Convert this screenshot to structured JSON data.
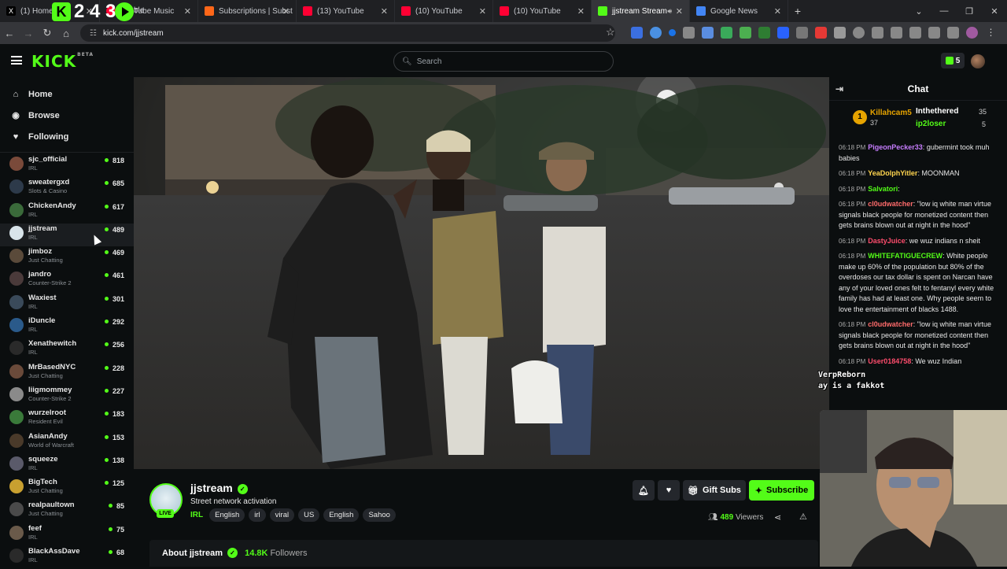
{
  "browser": {
    "tabs": [
      {
        "label": "(1) Home",
        "color": "#000000",
        "close": "✕"
      },
      {
        "label": "YouTube Music",
        "color": "#ff0033",
        "close": "✕"
      },
      {
        "label": "Subscriptions | Subst",
        "color": "#ff6719",
        "close": "✕"
      },
      {
        "label": "(13) YouTube",
        "color": "#ff0033",
        "close": "✕"
      },
      {
        "label": "(10) YouTube",
        "color": "#ff0033",
        "close": "✕"
      },
      {
        "label": "(10) YouTube",
        "color": "#ff0033",
        "close": "✕"
      },
      {
        "label": "jjstream Stream -",
        "color": "#53fc18",
        "close": "✕"
      },
      {
        "label": "Google News",
        "color": "#4285f4",
        "close": "✕"
      }
    ],
    "overlay_numbers": "2 4   3",
    "overlay_tab_fragment": "ble",
    "url": "kick.com/jjstream"
  },
  "header": {
    "logo": "KICK",
    "logo_beta": "BETA",
    "search_placeholder": "Search",
    "kicks_count": "5"
  },
  "sidebar": {
    "nav": [
      {
        "label": "Home",
        "icon": "⌂"
      },
      {
        "label": "Browse",
        "icon": "◉"
      },
      {
        "label": "Following",
        "icon": "♥"
      }
    ],
    "channels": [
      {
        "name": "sjc_official",
        "category": "IRL",
        "viewers": "818",
        "color": "#7a4a3a"
      },
      {
        "name": "sweatergxd",
        "category": "Slots & Casino",
        "viewers": "685",
        "color": "#2d3a4a"
      },
      {
        "name": "ChickenAndy",
        "category": "IRL",
        "viewers": "617",
        "color": "#3a6a3a"
      },
      {
        "name": "jjstream",
        "category": "IRL",
        "viewers": "489",
        "color": "#d8e4ea"
      },
      {
        "name": "jimboz",
        "category": "Just Chatting",
        "viewers": "469",
        "color": "#5a4a3a"
      },
      {
        "name": "jandro",
        "category": "Counter-Strike 2",
        "viewers": "461",
        "color": "#4a3a3a"
      },
      {
        "name": "Waxiest",
        "category": "IRL",
        "viewers": "301",
        "color": "#3a4a5a"
      },
      {
        "name": "iDuncle",
        "category": "IRL",
        "viewers": "292",
        "color": "#2a5a8a"
      },
      {
        "name": "Xenathewitch",
        "category": "IRL",
        "viewers": "256",
        "color": "#2a2a2a"
      },
      {
        "name": "MrBasedNYC",
        "category": "Just Chatting",
        "viewers": "228",
        "color": "#6a4a3a"
      },
      {
        "name": "liigmommey",
        "category": "Counter-Strike 2",
        "viewers": "227",
        "color": "#8a8a8a"
      },
      {
        "name": "wurzelroot",
        "category": "Resident Evil",
        "viewers": "183",
        "color": "#3a7a3a"
      },
      {
        "name": "AsianAndy",
        "category": "World of Warcraft",
        "viewers": "153",
        "color": "#4a3a2a"
      },
      {
        "name": "squeeze",
        "category": "IRL",
        "viewers": "138",
        "color": "#5a5a6a"
      },
      {
        "name": "BigTech",
        "category": "Just Chatting",
        "viewers": "125",
        "color": "#c8a030"
      },
      {
        "name": "realpaultown",
        "category": "Just Chatting",
        "viewers": "85",
        "color": "#4a4a4a"
      },
      {
        "name": "feef",
        "category": "IRL",
        "viewers": "75",
        "color": "#6a5a4a"
      },
      {
        "name": "BlackAssDave",
        "category": "IRL",
        "viewers": "68",
        "color": "#2a2a2a"
      }
    ]
  },
  "stream": {
    "channel": "jjstream",
    "live_label": "LIVE",
    "title": "Street network activation",
    "category": "IRL",
    "tags": [
      "English",
      "irl",
      "viral",
      "US",
      "English",
      "Sahoo"
    ],
    "gift_label": "Gift Subs",
    "subscribe_label": "Subscribe",
    "viewers_count": "489",
    "viewers_label": "Viewers",
    "about_label": "About jjstream",
    "followers_count": "14.8K",
    "followers_label": "Followers"
  },
  "chat": {
    "title": "Chat",
    "gifters": {
      "first": {
        "rank": "1",
        "name": "Killahcam5",
        "count": "37"
      },
      "second": {
        "name": "Inthethered",
        "count": "35"
      },
      "third": {
        "name": "ip2loser",
        "count": "5"
      }
    },
    "messages": [
      {
        "time": "06:18 PM",
        "user": "PigeonPecker33",
        "color": "#c77dff",
        "text": "gubermint took muh babies"
      },
      {
        "time": "06:18 PM",
        "user": "YeaDolphYitler",
        "color": "#ffd54f",
        "text": "MOONMAN"
      },
      {
        "time": "06:18 PM",
        "user": "Salvatori",
        "color": "#53fc18",
        "text": ""
      },
      {
        "time": "06:18 PM",
        "user": "cl0udwatcher",
        "color": "#ff6b6b",
        "text": "\"low iq white man virtue signals black people for monetized content then gets brains blown out at night in the hood\""
      },
      {
        "time": "06:18 PM",
        "user": "DastyJuice",
        "color": "#ff4d6d",
        "text": "we wuz indians n sheit"
      },
      {
        "time": "06:18 PM",
        "user": "WHITEFATIGUECREW",
        "color": "#53fc18",
        "text": "White people make up 60% of the population but 80% of the overdoses our tax dollar is spent on Narcan have any of your loved ones felt to fentanyl every white family has had at least one. Why people seem to love the entertainment of blacks 1488."
      },
      {
        "time": "06:18 PM",
        "user": "cl0udwatcher",
        "color": "#ff6b6b",
        "text": "\"low iq white man virtue signals black people for monetized content then gets brains blown out at night in the hood\""
      },
      {
        "time": "06:18 PM",
        "user": "User0184758",
        "color": "#ff4d6d",
        "text": "We wuz Indian"
      }
    ]
  },
  "overlay_text": {
    "line1": "VerpReborn",
    "line2": "ay is a fakkot"
  },
  "colors": {
    "accent": "#53fc18",
    "bg": "#0b0e0f"
  }
}
